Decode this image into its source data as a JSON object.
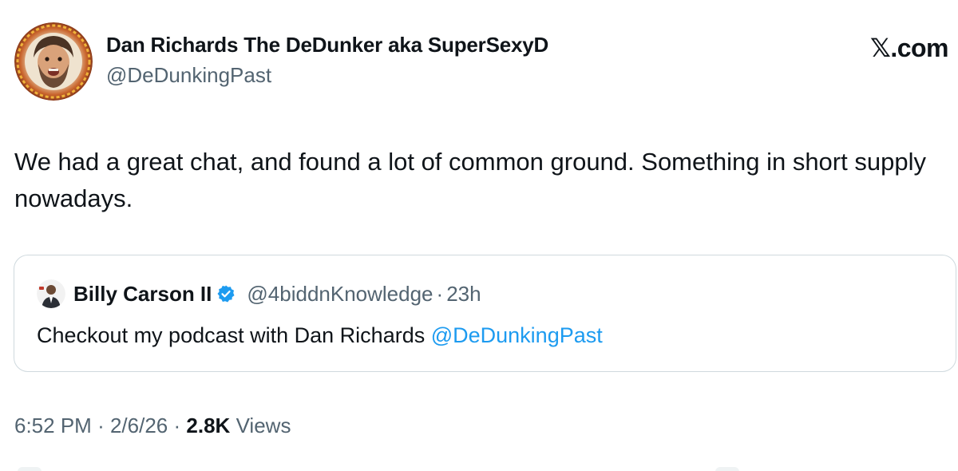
{
  "author": {
    "display_name": "Dan Richards The DeDunker aka SuperSexyD",
    "handle": "@DeDunkingPast"
  },
  "brand_label": "𝕏.com",
  "tweet": {
    "text": "We had a great chat, and found a lot of common ground. Something in short supply nowadays."
  },
  "quote": {
    "display_name": "Billy Carson II",
    "handle": "@4biddnKnowledge",
    "separator": "·",
    "time": "23h",
    "text_prefix": "Checkout my podcast with Dan Richards ",
    "mention": "@DeDunkingPast"
  },
  "meta": {
    "time": "6:52 PM",
    "separator": "·",
    "date": "2/6/26",
    "views_count": "2.8K",
    "views_label": "Views"
  },
  "colors": {
    "accent": "#1d9bf0",
    "secondary_text": "#536471",
    "primary_text": "#0f1419",
    "border": "#cfd9de"
  },
  "icons": {
    "verified": "verified-badge-icon"
  }
}
